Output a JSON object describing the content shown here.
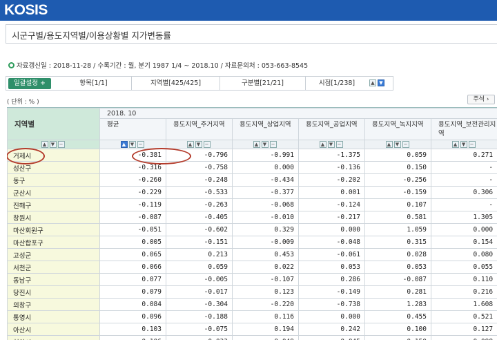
{
  "app": {
    "logo": "KOSIS"
  },
  "title": "시군구별/용도지역별/이용상황별 지가변동률",
  "info": "자료갱신일 : 2018-11-28 / 수록기간 : 월, 분기 1987 1/4 ~ 2018.10 / 자료문의처 : 053-663-8545",
  "toolbar": {
    "bulk_setting": "일괄설정 +",
    "tabs": [
      "항목[1/1]",
      "지역별[425/425]",
      "구분별[21/21]",
      "시점[1/238]"
    ]
  },
  "unit_label": "( 단위 : % )",
  "annotation_button": "주석 ›",
  "table": {
    "region_header": "지역별",
    "period": "2018. 10",
    "columns": [
      "평균",
      "용도지역_주거지역",
      "용도지역_상업지역",
      "용도지역_공업지역",
      "용도지역_녹지지역",
      "용도지역_보전관리지역"
    ],
    "rows": [
      {
        "name": "거제시",
        "values": [
          "-0.381",
          "-0.796",
          "-0.991",
          "-1.375",
          "0.059",
          "0.271"
        ]
      },
      {
        "name": "성산구",
        "values": [
          "-0.316",
          "-0.758",
          "0.000",
          "-0.136",
          "0.150",
          "-"
        ]
      },
      {
        "name": "동구",
        "values": [
          "-0.260",
          "-0.248",
          "-0.434",
          "-0.202",
          "-0.256",
          "-"
        ]
      },
      {
        "name": "군산시",
        "values": [
          "-0.229",
          "-0.533",
          "-0.377",
          "0.001",
          "-0.159",
          "0.306"
        ]
      },
      {
        "name": "진해구",
        "values": [
          "-0.119",
          "-0.263",
          "-0.068",
          "-0.124",
          "0.107",
          "-"
        ]
      },
      {
        "name": "창원시",
        "values": [
          "-0.087",
          "-0.405",
          "-0.010",
          "-0.217",
          "0.581",
          "1.305"
        ]
      },
      {
        "name": "마산회원구",
        "values": [
          "-0.051",
          "-0.602",
          "0.329",
          "0.000",
          "1.059",
          "0.000"
        ]
      },
      {
        "name": "마산합포구",
        "values": [
          "0.005",
          "-0.151",
          "-0.009",
          "-0.048",
          "0.315",
          "0.154"
        ]
      },
      {
        "name": "고성군",
        "values": [
          "0.065",
          "0.213",
          "0.453",
          "-0.061",
          "0.028",
          "0.080"
        ]
      },
      {
        "name": "서천군",
        "values": [
          "0.066",
          "0.059",
          "0.022",
          "0.053",
          "0.053",
          "0.055"
        ]
      },
      {
        "name": "동남구",
        "values": [
          "0.077",
          "-0.005",
          "-0.107",
          "0.286",
          "-0.087",
          "0.110"
        ]
      },
      {
        "name": "당진시",
        "values": [
          "0.079",
          "-0.017",
          "0.123",
          "-0.149",
          "0.281",
          "0.216"
        ]
      },
      {
        "name": "의창구",
        "values": [
          "0.084",
          "-0.304",
          "-0.220",
          "-0.738",
          "1.283",
          "1.608"
        ]
      },
      {
        "name": "통영시",
        "values": [
          "0.096",
          "-0.188",
          "0.116",
          "0.000",
          "0.455",
          "0.521"
        ]
      },
      {
        "name": "아산시",
        "values": [
          "0.103",
          "-0.075",
          "0.194",
          "0.242",
          "0.100",
          "0.127"
        ]
      },
      {
        "name": "천안시",
        "values": [
          "0.106",
          "0.033",
          "0.049",
          "0.045",
          "0.150",
          "0.098"
        ]
      }
    ]
  },
  "colors": {
    "topbar": "#1e5bb0",
    "region_header": "#cfe9da",
    "row_name_bg": "#f7f9dd",
    "highlight_circle": "#b33a2a"
  }
}
